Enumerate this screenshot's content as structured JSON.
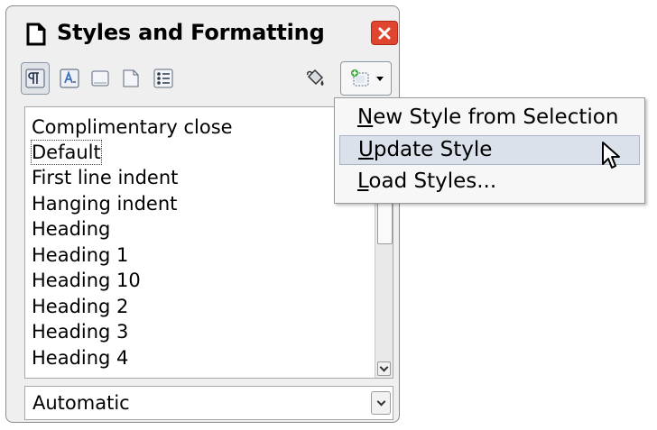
{
  "window": {
    "title": "Styles and Formatting",
    "title_icon": "document-icon",
    "close_icon": "close-icon",
    "close_color": "#e0452f"
  },
  "toolbar": {
    "buttons": [
      {
        "name": "paragraph-styles",
        "icon": "paragraph-styles-icon",
        "active": true
      },
      {
        "name": "character-styles",
        "icon": "character-styles-icon",
        "active": false
      },
      {
        "name": "frame-styles",
        "icon": "frame-styles-icon",
        "active": false
      },
      {
        "name": "page-styles",
        "icon": "page-styles-icon",
        "active": false
      },
      {
        "name": "list-styles",
        "icon": "list-styles-icon",
        "active": false
      },
      {
        "name": "fill-format-mode",
        "icon": "paint-bucket-icon",
        "active": false
      },
      {
        "name": "new-style-from-selection",
        "icon": "new-style-icon",
        "active": false
      }
    ]
  },
  "style_list": {
    "items": [
      "Complimentary close",
      "Default",
      "First line indent",
      "Hanging indent",
      "Heading",
      "Heading 1",
      "Heading 10",
      "Heading 2",
      "Heading 3",
      "Heading 4"
    ],
    "selected": "Default"
  },
  "filter": {
    "value": "Automatic"
  },
  "menu": {
    "items": [
      {
        "mnemonic": "N",
        "rest": "ew Style from Selection",
        "hover": false
      },
      {
        "mnemonic": "U",
        "rest": "pdate Style",
        "hover": true
      },
      {
        "mnemonic": "L",
        "rest": "oad Styles...",
        "hover": false
      }
    ],
    "hover_color": "#dbe1ea"
  }
}
